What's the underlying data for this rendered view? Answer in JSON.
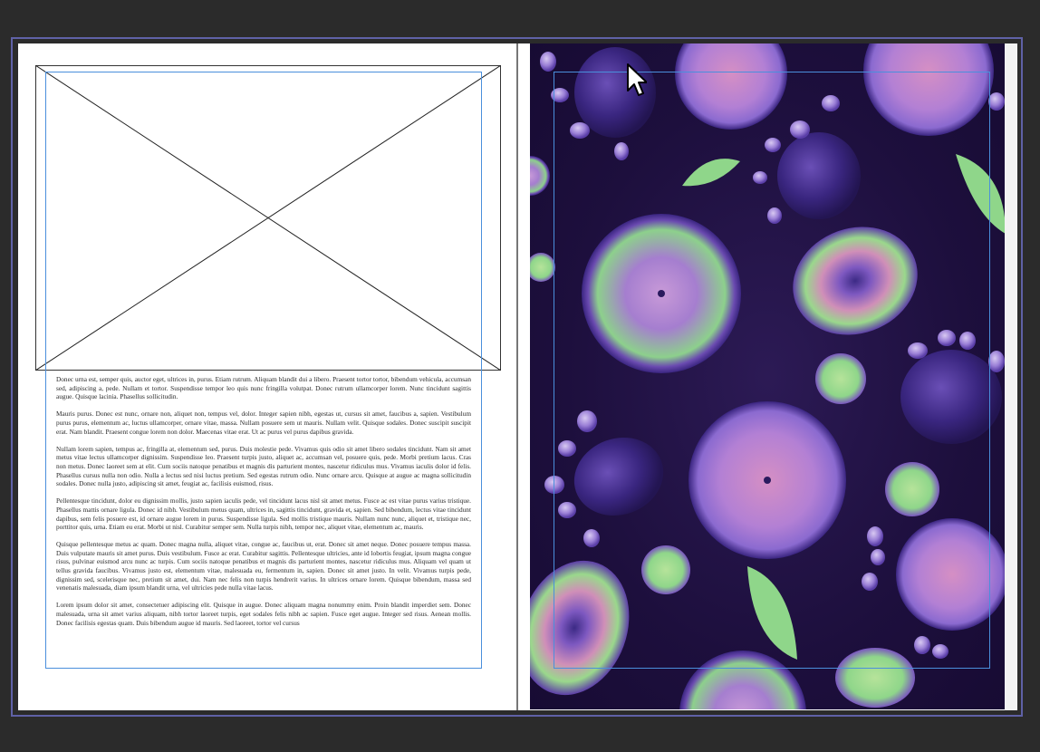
{
  "document": {
    "paragraphs": [
      "Donec urna est, semper quis, auctor eget, ultrices in, purus. Etiam rutrum. Aliquam blandit dui a libero. Praesent tortor tortor, bibendum vehicula, accumsan sed, adipiscing a, pede. Nullam et tortor. Suspendisse tempor leo quis nunc fringilla volutpat. Donec rutrum ullamcorper lorem. Nunc tincidunt sagittis augue. Quisque lacinia. Phasellus sollicitudin.",
      "Mauris purus. Donec est nunc, ornare non, aliquet non, tempus vel, dolor. Integer sapien nibh, egestas ut, cursus sit amet, faucibus a, sapien. Vestibulum purus purus, elementum ac, luctus ullamcorper, ornare vitae, massa. Nullam posuere sem ut mauris. Nullam velit. Quisque sodales. Donec suscipit suscipit erat. Nam blandit. Praesent congue lorem non dolor. Maecenas vitae erat. Ut ac purus vel purus dapibus gravida.",
      "Nullam lorem sapien, tempus ac, fringilla at, elementum sed, purus. Duis molestie pede. Vivamus quis odio sit amet libero sodales tincidunt. Nam sit amet metus vitae lectus ullamcorper dignissim. Suspendisse leo. Praesent turpis justo, aliquet ac, accumsan vel, posuere quis, pede. Morbi pretium lacus. Cras non metus. Donec laoreet sem at elit. Cum sociis natoque penatibus et magnis dis parturient montes, nascetur ridiculus mus. Vivamus iaculis dolor id felis. Phasellus cursus nulla non odio. Nulla a lectus sed nisi luctus pretium. Sed egestas rutrum odio. Nunc ornare arcu. Quisque at augue ac magna sollicitudin sodales. Donec nulla justo, adipiscing sit amet, feugiat ac, facilisis euismod, risus.",
      "Pellentesque tincidunt, dolor eu dignissim mollis, justo sapien iaculis pede, vel tincidunt lacus nisl sit amet metus. Fusce ac est vitae purus varius tristique. Phasellus mattis ornare ligula. Donec id nibh. Vestibulum metus quam, ultrices in, sagittis tincidunt, gravida et, sapien. Sed bibendum, lectus vitae tincidunt dapibus, sem felis posuere est, id ornare augue lorem in purus. Suspendisse ligula. Sed mollis tristique mauris. Nullam nunc nunc, aliquet et, tristique nec, porttitor quis, urna. Etiam eu erat. Morbi ut nisl. Curabitur semper sem. Nulla turpis nibh, tempor nec, aliquet vitae, elementum ac, mauris.",
      "Quisque pellentesque metus ac quam. Donec magna nulla, aliquet vitae, congue ac, faucibus ut, erat. Donec sit amet neque. Donec posuere tempus massa. Duis vulputate mauris sit amet purus. Duis vestibulum. Fusce ac erat. Curabitur sagittis. Pellentesque ultricies, ante id lobortis feugiat, ipsum magna congue risus, pulvinar euismod arcu nunc ac turpis. Cum sociis natoque penatibus et magnis dis parturient montes, nascetur ridiculus mus. Aliquam vel quam ut tellus gravida faucibus. Vivamus justo est, elementum vitae, malesuada eu, fermentum in, sapien. Donec sit amet justo. In velit. Vivamus turpis pede, dignissim sed, scelerisque nec, pretium sit amet, dui. Nam nec felis non turpis hendrerit varius. In ultrices ornare lorem. Quisque bibendum, massa sed venenatis malesuada, diam ipsum blandit urna, vel ultricies pede nulla vitae lacus.",
      "Lorem ipsum dolor sit amet, consectetuer adipiscing elit. Quisque in augue. Donec aliquam magna nonummy enim. Proin blandit imperdiet sem. Donec malesuada, urna sit amet varius aliquam, nibh tortor laoreet turpis, eget sodales felis nibh ac sapien. Fusce eget augue. Integer sed risus. Aenean mollis. Donec facilisis egestas quam. Duis bibendum augue id mauris. Sed laoreet, tortor vel cursus"
    ]
  },
  "icons": {
    "cursor": "arrow-pointer-icon",
    "placeholder": "empty-image-frame-icon"
  },
  "colors": {
    "frame_guide": "#4a8fdc",
    "spread_border": "#5f61a6",
    "photo_background": "#1d0f3d",
    "fruit_green": "#8fd68a",
    "fruit_violet": "#8a6bd6"
  }
}
